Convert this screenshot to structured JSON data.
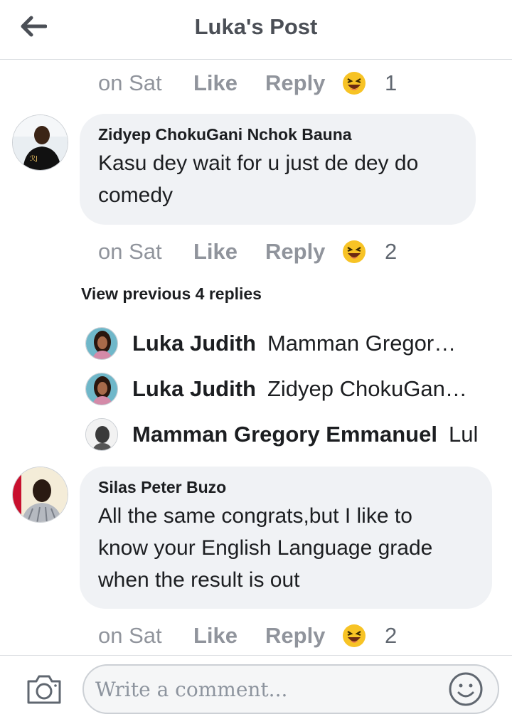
{
  "header": {
    "title": "Luka's Post",
    "back_icon": "arrow-left-icon"
  },
  "comments": [
    {
      "actions": {
        "time": "on Sat",
        "like": "Like",
        "reply": "Reply",
        "reaction": "laughing-emoji-icon",
        "count": "1"
      }
    },
    {
      "author": "Zidyep ChokuGani Nchok Bauna",
      "text_line1": "Kasu dey wait for u just de dey do",
      "text_line2": "comedy",
      "actions": {
        "time": "on Sat",
        "like": "Like",
        "reply": "Reply",
        "reaction": "laughing-emoji-icon",
        "count": "2"
      },
      "view_previous": "View previous 4 replies",
      "replies": [
        {
          "name": "Luka Judith",
          "snippet": "Mamman Gregor…"
        },
        {
          "name": "Luka Judith",
          "snippet": "Zidyep ChokuGan…"
        },
        {
          "name": "Mamman Gregory Emmanuel",
          "snippet": "Lul"
        }
      ]
    },
    {
      "author": "Silas Peter Buzo",
      "text_line1": "All the same congrats,but I like to",
      "text_line2": "know your English Language grade",
      "text_line3": "when the result is out",
      "actions": {
        "time": "on Sat",
        "like": "Like",
        "reply": "Reply",
        "reaction": "laughing-emoji-icon",
        "count": "2"
      }
    }
  ],
  "composer": {
    "placeholder": "Write a comment...",
    "camera_icon": "camera-icon",
    "emoji_icon": "smiley-icon"
  },
  "colors": {
    "bubble": "#f0f2f5",
    "meta_text": "#90949c",
    "divider": "#dadde1"
  }
}
